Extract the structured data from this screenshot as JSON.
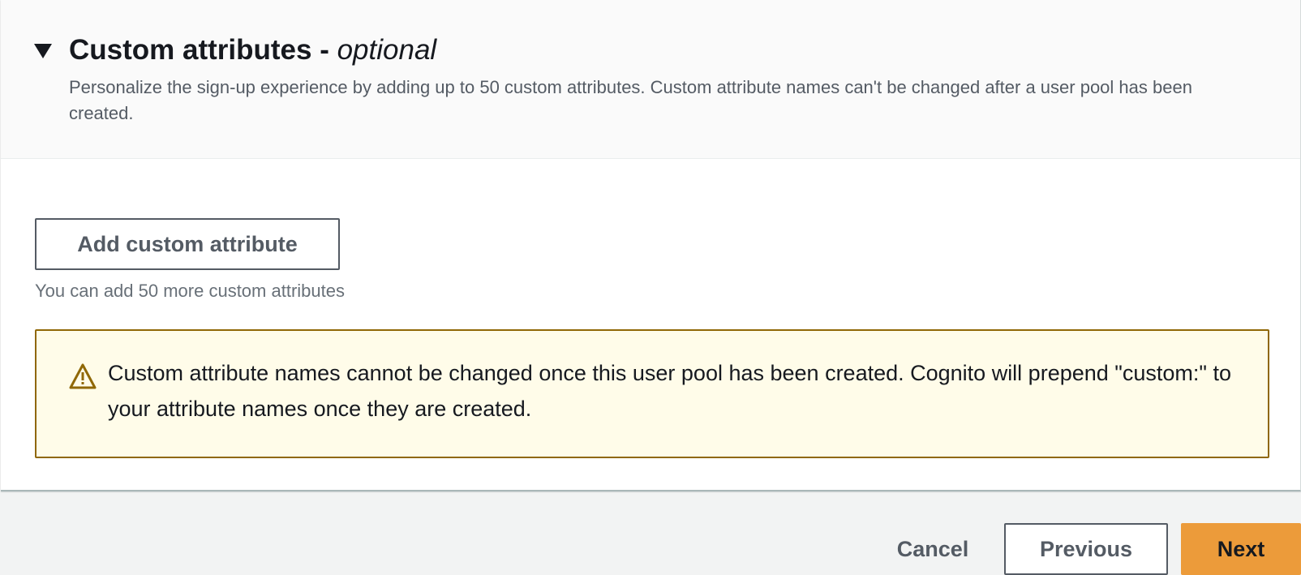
{
  "section": {
    "title": "Custom attributes - ",
    "title_optional": "optional",
    "description": "Personalize the sign-up experience by adding up to 50 custom attributes. Custom attribute names can't be changed after a user pool has been created.",
    "expand_icon": "caret-down-icon"
  },
  "add_button": {
    "label": "Add custom attribute"
  },
  "hint": "You can add 50 more custom attributes",
  "alert": {
    "icon": "warning-icon",
    "text": "Custom attribute names cannot be changed once this user pool has been created. Cognito will prepend \"custom:\" to your attribute names once they are created."
  },
  "footer": {
    "cancel_label": "Cancel",
    "previous_label": "Previous",
    "next_label": "Next"
  },
  "colors": {
    "primary": "#ec9b3a",
    "warning_border": "#906806",
    "warning_bg": "#fffce9"
  }
}
